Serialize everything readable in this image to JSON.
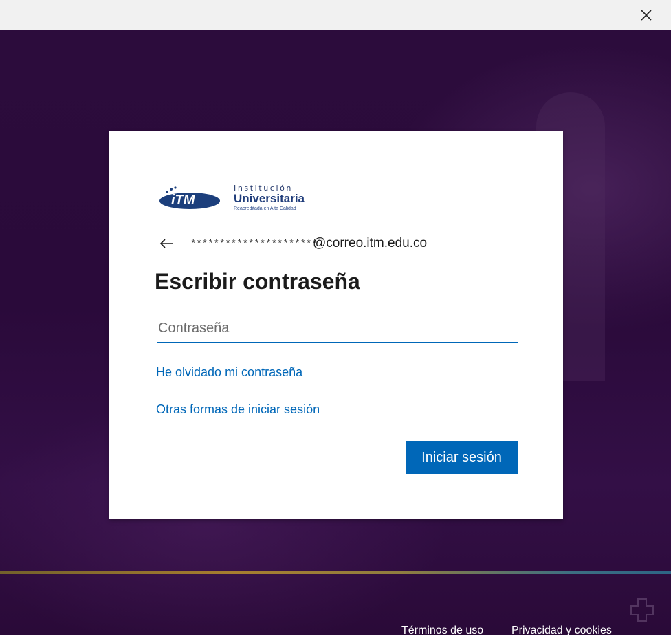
{
  "window": {
    "close_icon": "close-icon"
  },
  "logo": {
    "mark_text": "iTM",
    "small_text": "Institución",
    "main_text": "Universitaria",
    "tagline": "Reacreditada en Alta Calidad"
  },
  "identity": {
    "masked_user": "**********************",
    "domain": "@correo.itm.edu.co",
    "back_icon": "arrow-left-icon"
  },
  "form": {
    "heading": "Escribir contraseña",
    "password_placeholder": "Contraseña",
    "password_value": "",
    "forgot_link": "He olvidado mi contraseña",
    "other_ways_link": "Otras formas de iniciar sesión",
    "submit_label": "Iniciar sesión"
  },
  "footer": {
    "terms": "Términos de uso",
    "privacy": "Privacidad y cookies",
    "more_icon": "accessibility-icon"
  },
  "colors": {
    "accent": "#0067b8",
    "background": "#2c0c3c"
  }
}
